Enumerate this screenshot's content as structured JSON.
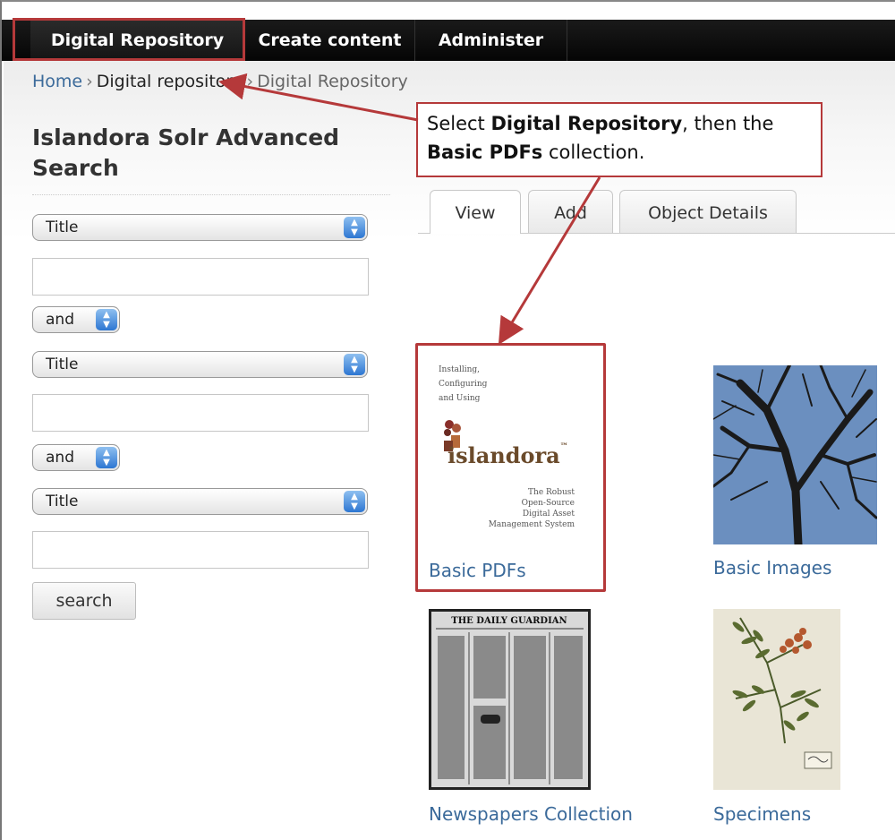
{
  "nav": {
    "items": [
      "Digital Repository",
      "Create content",
      "Administer"
    ]
  },
  "breadcrumb": {
    "home": "Home",
    "sep": "›",
    "current": "Digital repository",
    "tail": "Digital Repository"
  },
  "sidebar": {
    "title": "Islandora Solr Advanced Search",
    "fields": [
      {
        "field": "Title",
        "operator": "and"
      },
      {
        "field": "Title",
        "operator": "and"
      },
      {
        "field": "Title"
      }
    ],
    "search_label": "search"
  },
  "tabs": [
    "View",
    "Add",
    "Object Details"
  ],
  "callout": {
    "text_1": "Select ",
    "bold_1": "Digital Repository",
    "text_2": ", then the",
    "bold_2": "Basic PDFs",
    "text_3": " collection."
  },
  "collections": [
    {
      "label": "Basic PDFs"
    },
    {
      "label": "Basic Images"
    },
    {
      "label": "Newspapers Collection"
    },
    {
      "label": "Specimens"
    }
  ],
  "pdf_cover": {
    "line1": "Installing,",
    "line2": "Configuring",
    "line3": "and Using",
    "logo": "islandora",
    "tm": "™",
    "sub1": "The Robust",
    "sub2": "Open-Source",
    "sub3": "Digital Asset",
    "sub4": "Management System"
  },
  "newspaper": {
    "masthead": "THE DAILY GUARDIAN"
  },
  "colors": {
    "highlight": "#b5393a",
    "link": "#3b6a9a",
    "nav_bg": "#111111"
  },
  "icons": [
    "select-arrows-icon"
  ]
}
